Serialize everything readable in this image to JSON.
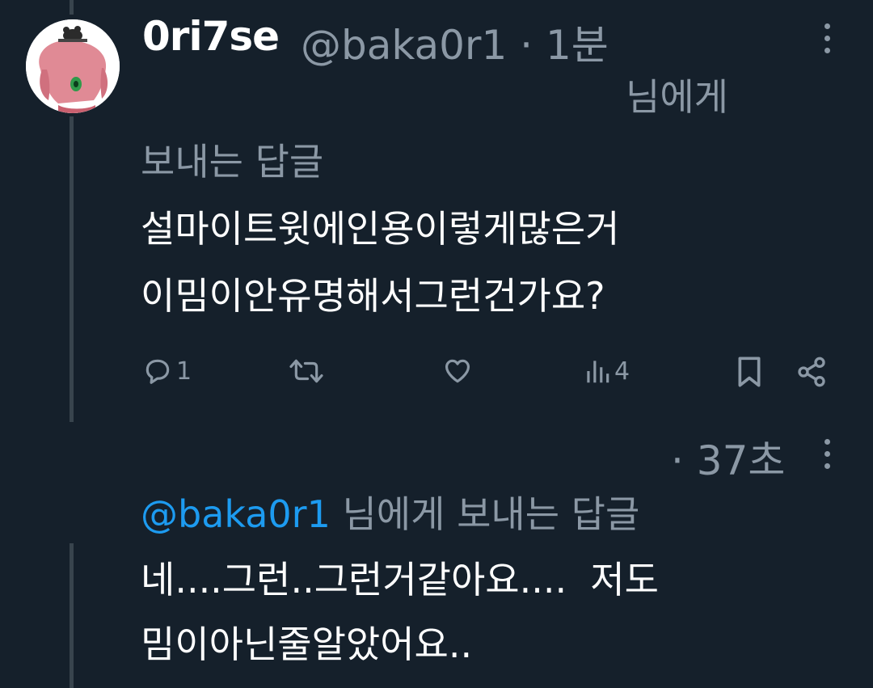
{
  "tweet1": {
    "display_name": "0ri7se",
    "handle_time": "@baka0r1 · 1분",
    "reply_to_a": "님에게",
    "reply_to_b": "보내는 답글",
    "body_line1": "설마이트윗에인용이렇게많은거",
    "body_line2": "이밈이안유명해서그런건가요?",
    "actions": {
      "reply_count": "1",
      "views_count": "4"
    }
  },
  "tweet2": {
    "time": "· 37초",
    "mention": "@baka0r1",
    "reply_suffix": "님에게 보내는 답글",
    "body_line1": "네....그런..그런거같아요....  저도",
    "body_line2": "밈이아닌줄알았어요.."
  },
  "colors": {
    "background": "#15202b",
    "text_primary": "#ffffff",
    "text_secondary": "#8b98a5",
    "accent": "#1d9bf0",
    "thread_line": "#38444d"
  },
  "icons": [
    "more-icon",
    "reply-icon",
    "retweet-icon",
    "like-icon",
    "views-icon",
    "bookmark-icon",
    "share-icon"
  ]
}
